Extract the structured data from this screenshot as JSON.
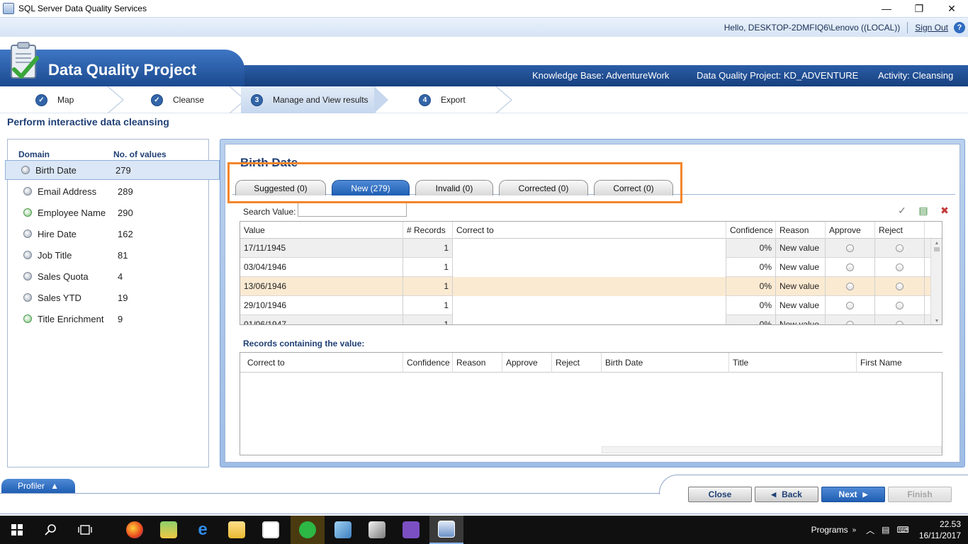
{
  "window": {
    "title": "SQL Server Data Quality Services",
    "minimize_glyph": "—",
    "maximize_glyph": "❐",
    "close_glyph": "✕"
  },
  "hello_bar": {
    "greeting": "Hello, DESKTOP-2DMFIQ6\\Lenovo ((LOCAL))",
    "sign_out": "Sign Out",
    "help_glyph": "?"
  },
  "banner": {
    "product_title": "Data Quality Project",
    "knowledge_base": "Knowledge Base: AdventureWork",
    "project": "Data Quality Project: KD_ADVENTURE",
    "activity": "Activity: Cleansing"
  },
  "steps": [
    {
      "num": "✓",
      "label": "Map"
    },
    {
      "num": "✓",
      "label": "Cleanse"
    },
    {
      "num": "3",
      "label": "Manage and View results"
    },
    {
      "num": "4",
      "label": "Export"
    }
  ],
  "page_heading": "Perform interactive data cleansing",
  "domains": {
    "header_domain": "Domain",
    "header_count": "No. of values",
    "items": [
      {
        "name": "Birth Date",
        "count": "279",
        "icon": "domain-icon"
      },
      {
        "name": "Email Address",
        "count": "289",
        "icon": "domain-icon"
      },
      {
        "name": "Employee Name",
        "count": "290",
        "icon": "composite-domain-icon"
      },
      {
        "name": "Hire Date",
        "count": "162",
        "icon": "domain-icon"
      },
      {
        "name": "Job Title",
        "count": "81",
        "icon": "domain-icon"
      },
      {
        "name": "Sales Quota",
        "count": "4",
        "icon": "domain-icon"
      },
      {
        "name": "Sales YTD",
        "count": "19",
        "icon": "domain-icon"
      },
      {
        "name": "Title Enrichment",
        "count": "9",
        "icon": "composite-domain-icon"
      }
    ]
  },
  "main": {
    "domain_title": "Birth Date",
    "tabs": [
      "Suggested (0)",
      "New (279)",
      "Invalid (0)",
      "Corrected (0)",
      "Correct (0)"
    ],
    "active_tab": "New (279)",
    "search_label": "Search Value:",
    "search_value": "",
    "tool_icons": [
      "approve-all-icon",
      "export-icon",
      "reject-icon"
    ],
    "values_grid": {
      "columns": [
        "Value",
        "# Records",
        "Correct to",
        "Confidence",
        "Reason",
        "Approve",
        "Reject"
      ],
      "rows": [
        {
          "value": "17/11/1945",
          "records": "1",
          "correct_to": "",
          "confidence": "0%",
          "reason": "New value"
        },
        {
          "value": "03/04/1946",
          "records": "1",
          "correct_to": "",
          "confidence": "0%",
          "reason": "New value"
        },
        {
          "value": "13/06/1946",
          "records": "1",
          "correct_to": "",
          "confidence": "0%",
          "reason": "New value"
        },
        {
          "value": "29/10/1946",
          "records": "1",
          "correct_to": "",
          "confidence": "0%",
          "reason": "New value"
        },
        {
          "value": "01/06/1947",
          "records": "1",
          "correct_to": "",
          "confidence": "0%",
          "reason": "New value"
        }
      ]
    },
    "records_label": "Records containing the value:",
    "records_grid": {
      "columns": [
        "Correct to",
        "Confidence",
        "Reason",
        "Approve",
        "Reject",
        "Birth Date",
        "Title",
        "First Name"
      ]
    }
  },
  "bottom": {
    "profiler": "Profiler",
    "close": "Close",
    "back": "Back",
    "next": "Next",
    "finish": "Finish"
  },
  "taskbar": {
    "tray_programs": "Programs",
    "time": "22.53",
    "date": "16/11/2017"
  },
  "colors": {
    "accent_blue": "#1f5eb3",
    "highlight_orange": "#f3862b",
    "selected_row": "#fbead2"
  }
}
